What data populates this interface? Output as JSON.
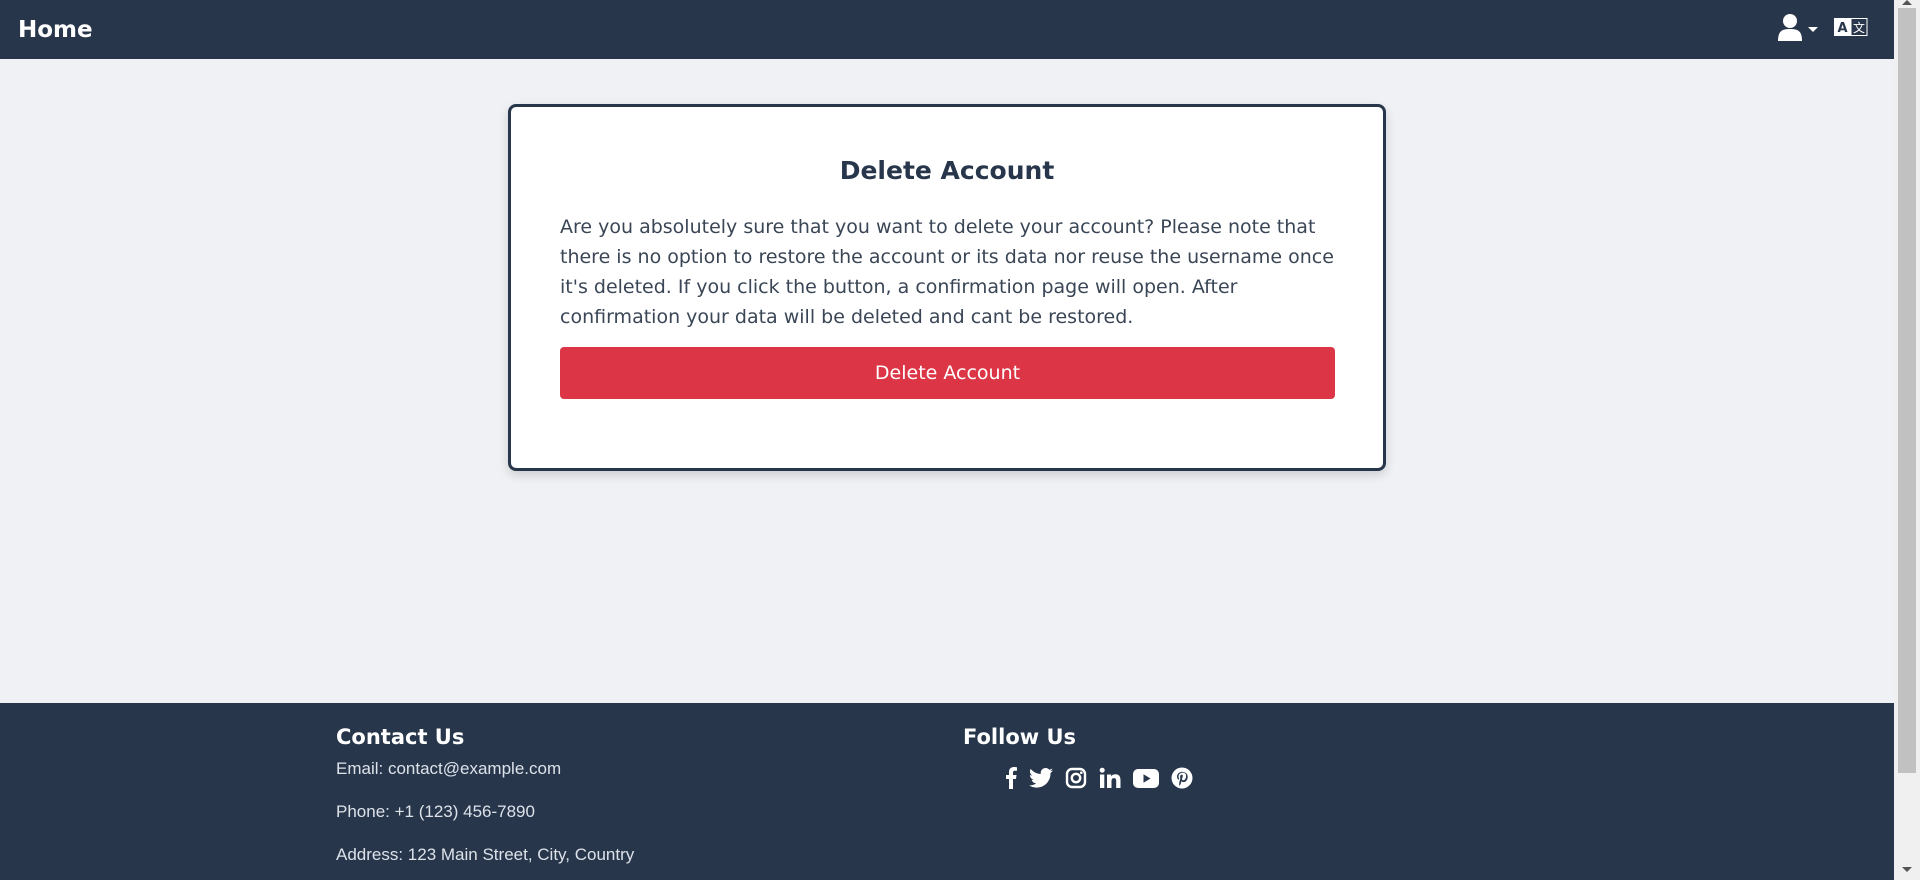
{
  "navbar": {
    "brand": "Home",
    "user_icon": "user-icon",
    "language_icon": "translate-icon"
  },
  "card": {
    "title": "Delete Account",
    "text": "Are you absolutely sure that you want to delete your account? Please note that there is no option to restore the account or its data nor reuse the username once it's deleted. If you click the button, a confirmation page will open. After confirmation your data will be deleted and cant be restored.",
    "button_label": "Delete Account"
  },
  "footer": {
    "contact_heading": "Contact Us",
    "email": "Email: contact@example.com",
    "phone": "Phone: +1 (123) 456-7890",
    "address": "Address: 123 Main Street, City, Country",
    "follow_heading": "Follow Us",
    "socials": [
      "facebook-icon",
      "twitter-icon",
      "instagram-icon",
      "linkedin-icon",
      "youtube-icon",
      "pinterest-icon"
    ]
  },
  "colors": {
    "navbar": "#27364a",
    "background": "#eff1f5",
    "danger": "#dc3545"
  }
}
